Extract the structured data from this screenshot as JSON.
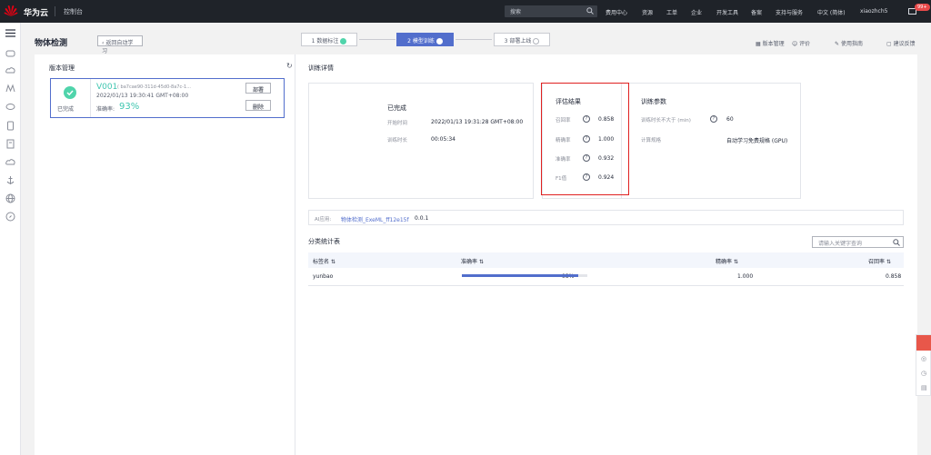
{
  "topbar": {
    "brand": "华为云",
    "console": "控制台",
    "search_placeholder": "搜索",
    "nav": [
      "费用中心",
      "资源",
      "工单",
      "企业",
      "开发工具",
      "备案",
      "支持与服务",
      "中文 (简体)",
      "xiaozhch5"
    ],
    "badge": "99+"
  },
  "page": {
    "title": "物体检测",
    "back": "返回自动学习",
    "steps": [
      {
        "label": "1 数据标注",
        "state": "done"
      },
      {
        "label": "2 模型训练",
        "state": "active"
      },
      {
        "label": "3 部署上线",
        "state": "pending"
      }
    ],
    "toolbar": {
      "version_mgmt": "版本管理",
      "rate": "评价",
      "guide": "使用指南",
      "feedback": "建议反馈"
    }
  },
  "left": {
    "title": "版本管理",
    "card": {
      "status": "已完成",
      "version": "V001",
      "id": "( ba7cae90-311d-45d0-8a7c-1...",
      "time": "2022/01/13 19:30:41 GMT+08:00",
      "acc_label": "准确率:",
      "acc_value": "93%",
      "deploy": "部署",
      "delete": "删除"
    }
  },
  "right": {
    "title": "训练详情",
    "completed": {
      "title": "已完成",
      "start_label": "开始时间",
      "start_value": "2022/01/13 19:31:28 GMT+08:00",
      "duration_label": "训练时长",
      "duration_value": "00:05:34"
    },
    "eval": {
      "title": "评估结果",
      "rows": [
        {
          "label": "召回率",
          "value": "0.858"
        },
        {
          "label": "精确率",
          "value": "1.000"
        },
        {
          "label": "准确率",
          "value": "0.932"
        },
        {
          "label": "F1值",
          "value": "0.924"
        }
      ]
    },
    "params": {
      "title": "训练参数",
      "rows": [
        {
          "label": "训练时长不大于 (min)",
          "value": "60"
        },
        {
          "label": "计算规格",
          "value": "自动学习免费规格 (GPU)"
        }
      ]
    },
    "ai_app": {
      "label": "AI应用:",
      "name": "物体检测_ExeML_ff12e15f",
      "version": "0.0.1"
    },
    "table": {
      "title": "分类统计表",
      "search_placeholder": "请输入关键字查询",
      "headers": [
        "标签名",
        "准确率",
        "精确率",
        "召回率"
      ],
      "rows": [
        {
          "label": "yunbao",
          "accuracy": "93%",
          "accuracy_fraction": 0.93,
          "precision": "1.000",
          "recall": "0.858"
        }
      ]
    }
  }
}
